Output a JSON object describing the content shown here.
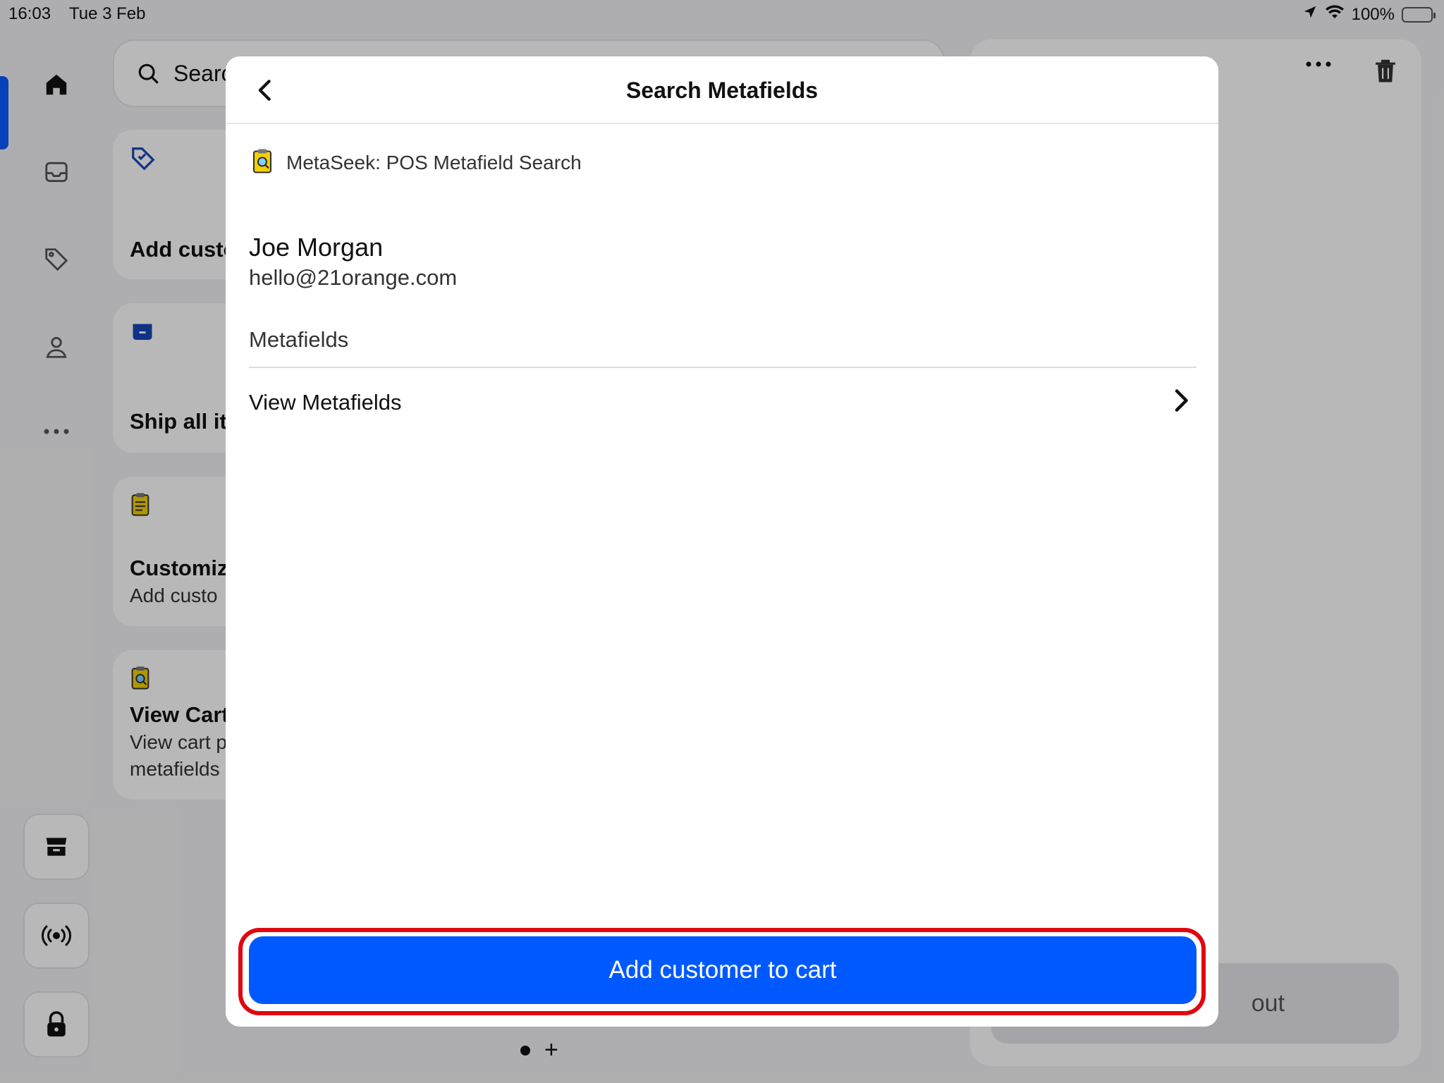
{
  "status_bar": {
    "time": "16:03",
    "date": "Tue 3 Feb",
    "battery": "100%",
    "icons": [
      "location-arrow-icon",
      "wifi-icon",
      "battery-charging-icon"
    ]
  },
  "background": {
    "search_placeholder": "Search",
    "rail_icons": [
      "home-icon",
      "inbox-icon",
      "tag-icon",
      "person-icon",
      "more-icon",
      "store-icon",
      "broadcast-icon",
      "lock-icon"
    ],
    "tiles": [
      {
        "title": "Add custo",
        "subtitle": "",
        "icon": "tag-edit-icon"
      },
      {
        "title": "Ship all ite",
        "subtitle": "",
        "icon": "box-icon"
      },
      {
        "title": "Customiz",
        "subtitle": "Add custo",
        "icon": "clipboard-icon"
      },
      {
        "title": "View Cart",
        "subtitle": "View cart p",
        "subtitle2": "metafields",
        "icon": "clipboard-search-icon"
      }
    ],
    "checkout_label": "out",
    "pager_plus": "+"
  },
  "modal": {
    "title": "Search Metafields",
    "app_name": "MetaSeek: POS Metafield Search",
    "customer": {
      "name": "Joe Morgan",
      "email": "hello@21orange.com"
    },
    "section_label": "Metafields",
    "nav_item": "View Metafields",
    "primary_button": "Add customer to cart"
  },
  "colors": {
    "accent": "#0059ff",
    "highlight": "#e0070f",
    "scrim": "rgba(0,0,0,0.28)"
  }
}
